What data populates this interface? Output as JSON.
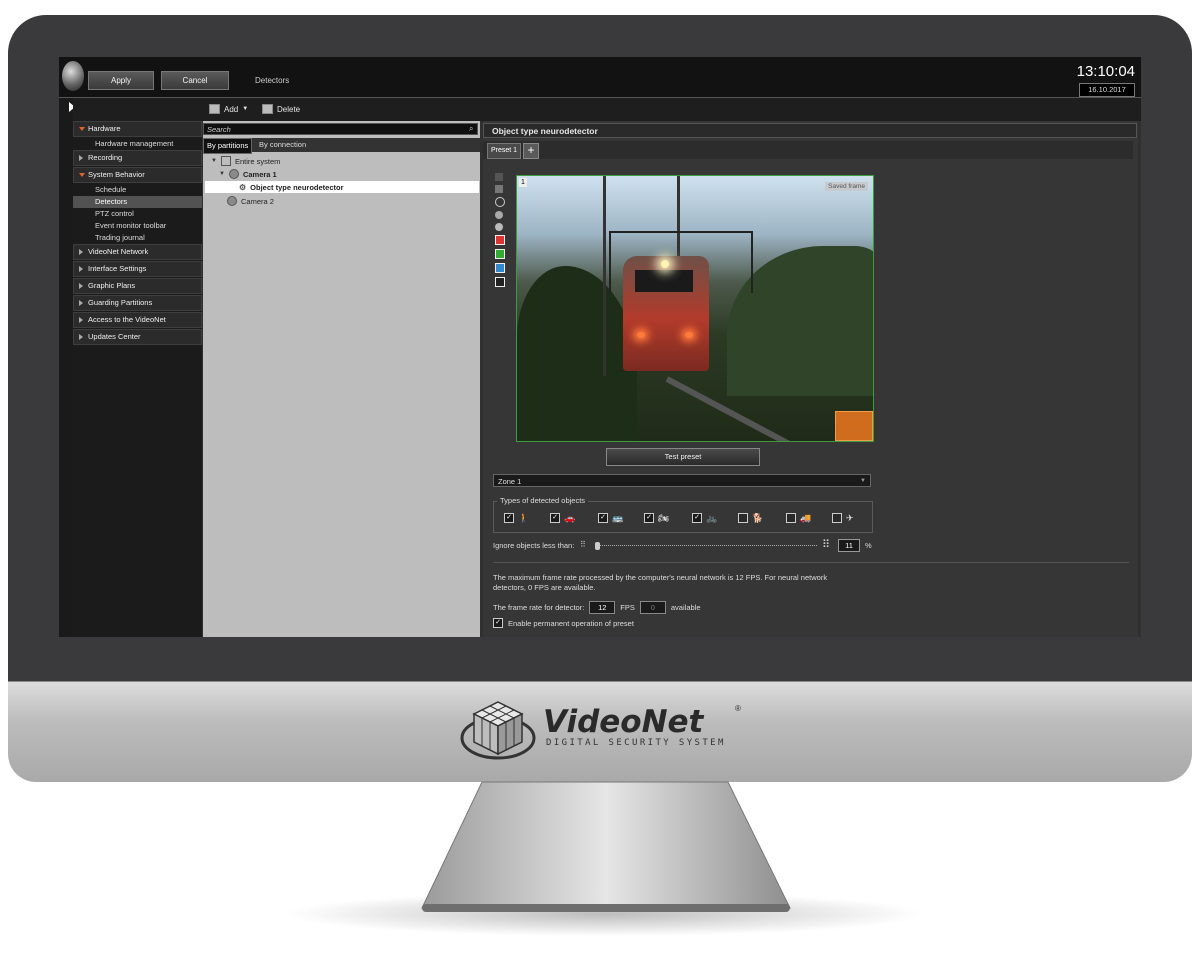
{
  "topbar": {
    "apply_label": "Apply",
    "cancel_label": "Cancel",
    "section_title": "Detectors",
    "time": "13:10:04",
    "date": "16.10.2017"
  },
  "toolbar": {
    "add_label": "Add",
    "delete_label": "Delete"
  },
  "nav": {
    "hardware": "Hardware",
    "hardware_management": "Hardware management",
    "recording": "Recording",
    "system_behavior": "System Behavior",
    "schedule": "Schedule",
    "detectors": "Detectors",
    "ptz_control": "PTZ control",
    "event_monitor_toolbar": "Event monitor toolbar",
    "trading_journal": "Trading journal",
    "videonet_network": "VideoNet Network",
    "interface_settings": "Interface Settings",
    "graphic_plans": "Graphic Plans",
    "guarding_partitions": "Guarding Partitions",
    "access_to_videonet": "Access to the VideoNet",
    "updates_center": "Updates Center"
  },
  "tree": {
    "search_placeholder": "Search",
    "tab_partitions": "By partitions",
    "tab_connection": "By connection",
    "entire_system": "Entire system",
    "camera1": "Camera 1",
    "detector": "Object type neurodetector",
    "camera2": "Camera 2"
  },
  "detector": {
    "title": "Object type neurodetector",
    "preset_tab": "Preset 1",
    "zone_number": "1",
    "saved_frame": "Saved frame",
    "test_preset": "Test preset",
    "zone_selected": "Zone 1",
    "types_legend": "Types of detected objects",
    "ignore_label": "Ignore objects less than:",
    "ignore_value": "11",
    "ignore_unit": "%",
    "info_text": "The maximum frame rate processed by the computer's neural network is 12 FPS. For neural network detectors, 0 FPS are available.",
    "fps_label": "The frame rate for detector:",
    "fps_value": "12",
    "fps_unit": "FPS",
    "fps_available_value": "0",
    "fps_available_label": "available",
    "permanent_label": "Enable permanent operation of preset"
  },
  "object_types": [
    {
      "icon": "person-icon",
      "checked": true
    },
    {
      "icon": "car-icon",
      "checked": true
    },
    {
      "icon": "bus-icon",
      "checked": true
    },
    {
      "icon": "motorcycle-icon",
      "checked": true
    },
    {
      "icon": "bicycle-icon",
      "checked": true
    },
    {
      "icon": "dog-icon",
      "checked": false
    },
    {
      "icon": "truck-icon",
      "checked": false
    },
    {
      "icon": "airplane-icon",
      "checked": false
    }
  ],
  "brand": {
    "name": "VideoNet",
    "reg": "®",
    "tagline": "DIGITAL SECURITY SYSTEM"
  }
}
